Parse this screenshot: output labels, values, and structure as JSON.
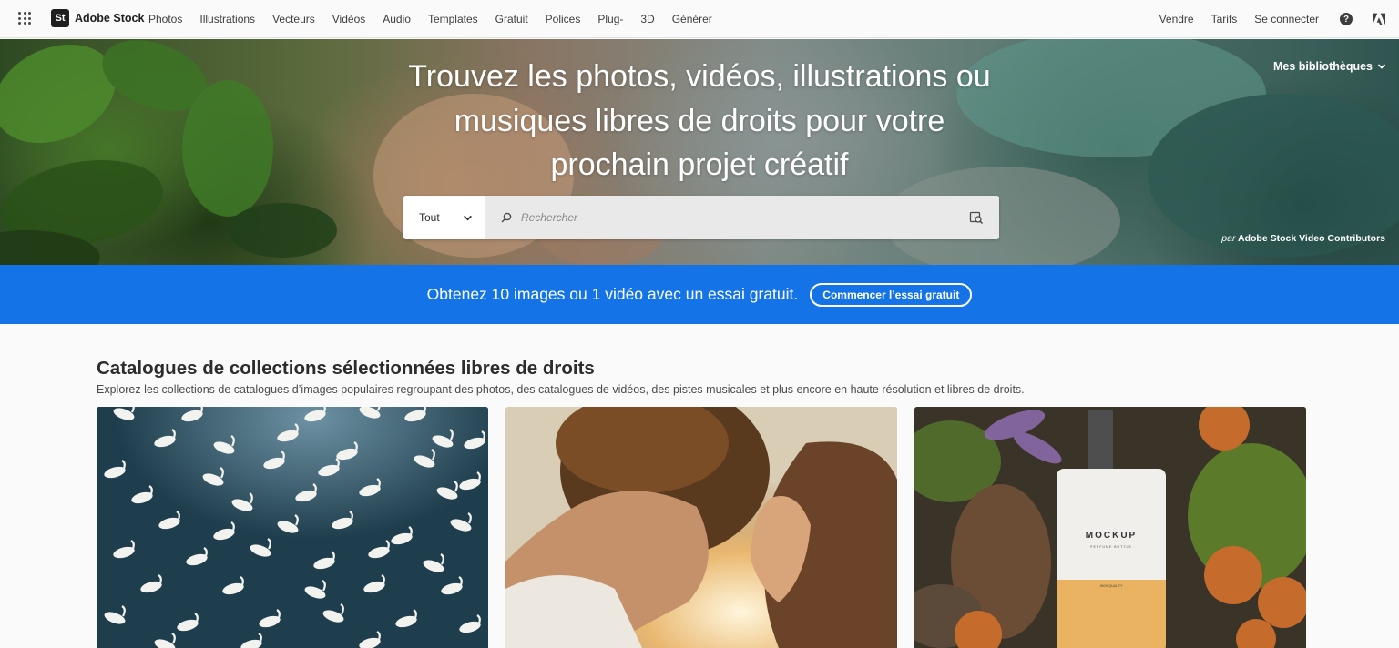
{
  "nav": {
    "apps_icon": "app-switcher-grid-icon",
    "logo_text": "St",
    "brand": "Adobe Stock",
    "links": [
      "Photos",
      "Illustrations",
      "Vecteurs",
      "Vidéos",
      "Audio",
      "Templates",
      "Gratuit",
      "Polices",
      "Plug-",
      "3D",
      "Générer"
    ],
    "right_links": [
      "Vendre",
      "Tarifs",
      "Se connecter"
    ],
    "help_icon": "help-icon",
    "adobe_icon": "adobe-logo-icon"
  },
  "hero": {
    "title_line1": "Trouvez les photos, vidéos, illustrations ou",
    "title_line2": "musiques libres de droits pour votre",
    "title_line3": "prochain projet créatif",
    "libraries": "Mes bibliothèques",
    "credit_prefix": "par",
    "credit_name": "Adobe Stock Video Contributors",
    "search": {
      "scope": "Tout",
      "placeholder": "Rechercher",
      "value": ""
    }
  },
  "promo": {
    "text": "Obtenez 10 images ou 1 vidéo avec un essai gratuit.",
    "button": "Commencer l’essai gratuit",
    "color": "#1473e6"
  },
  "collections": {
    "title": "Catalogues de collections sélectionnées libres de droits",
    "subtitle": "Explorez les collections de catalogues d’images populaires regroupant des photos, des catalogues de vidéos, des pistes musicales et plus encore en haute résolution et libres de droits.",
    "cards": [
      {
        "image": "swans-aerial-photo"
      },
      {
        "image": "couple-sunset-photo"
      },
      {
        "image": "perfume-mockup-photo",
        "mockup_label": "MOCKUP",
        "mockup_sub": "PERFUME BOTTLE",
        "mockup_quality": "HIGH QUALITY"
      }
    ]
  }
}
